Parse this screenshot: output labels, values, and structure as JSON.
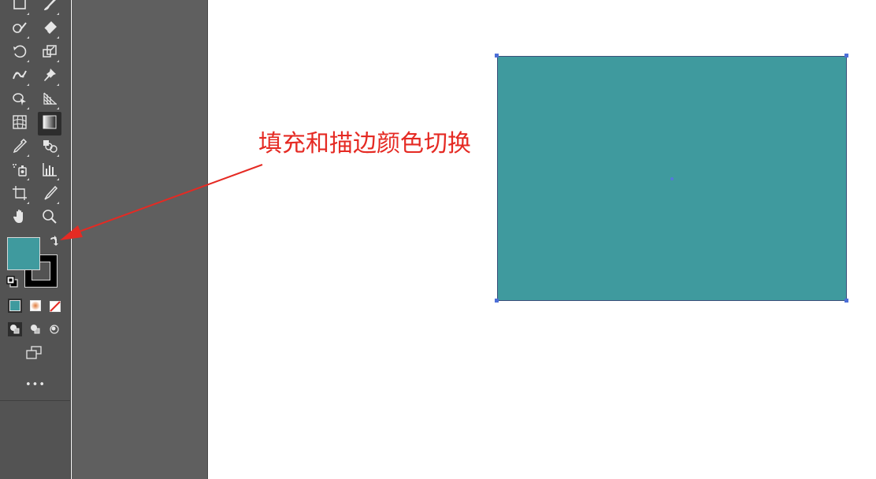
{
  "annotation": {
    "text": "填充和描边颜色切换",
    "color": "#e52a23"
  },
  "colors": {
    "fill": "#3f9a9e",
    "stroke": "#000000",
    "toolbar_bg": "#535353",
    "gutter_bg": "#5f5f5f",
    "selection": "#4d6fd8"
  },
  "toolbar": {
    "more_label": "•••",
    "tools": [
      "rectangle-icon",
      "paintbrush-icon",
      "shaper-icon",
      "eraser-icon",
      "rotate-icon",
      "scale-icon",
      "puppet-warp-icon",
      "pin-icon",
      "shape-builder-icon",
      "perspective-grid-icon",
      "mesh-icon",
      "gradient-icon",
      "eyedropper-icon",
      "blend-icon",
      "symbol-sprayer-icon",
      "column-graph-icon",
      "artboard-icon",
      "slice-icon",
      "hand-icon",
      "zoom-icon"
    ]
  }
}
